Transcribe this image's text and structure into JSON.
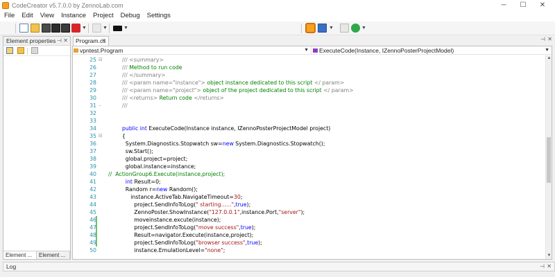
{
  "window": {
    "title": "CodeCreator v5.7.0.0 by ZennoLab.com",
    "minimize": "─",
    "maximize": "☐",
    "close": "✕"
  },
  "menu": [
    "File",
    "Edit",
    "View",
    "Instance",
    "Project",
    "Debug",
    "Settings"
  ],
  "toolbar": {
    "buttons": [
      "new-icon",
      "open-folder-icon",
      "save-icon",
      "save-all-icon",
      "save-as-icon",
      "delete-icon",
      "copy-icon",
      "console-icon",
      "run-project-icon",
      "record-icon",
      "settings-icon",
      "play-icon"
    ],
    "colors": {
      "orange": "#f7a21b",
      "red": "#d4262b",
      "green": "#2ea84a",
      "blue": "#3a6fc4"
    }
  },
  "left_panel": {
    "title": "Element properties",
    "pin": "⊣",
    "close": "✕",
    "tabs": [
      "Element ...",
      "Element ..."
    ]
  },
  "doc_tab": {
    "label": "Program.cs",
    "close": "✕",
    "pin": "⊣",
    "panel_close": "✕"
  },
  "nav": {
    "class_selector": "vpntest.Program",
    "member_selector": "ExecuteCode(Instance, IZennoPosterProjectModel)",
    "dropdown": "▼"
  },
  "code_lines": [
    {
      "num": "25",
      "fold": "⊟",
      "segs": [
        [
          "cg",
          "/// <summary>"
        ]
      ],
      "indent": "        "
    },
    {
      "num": "26",
      "fold": "",
      "segs": [
        [
          "cg",
          "/// "
        ],
        [
          "c",
          "Method to run code"
        ]
      ],
      "indent": "        "
    },
    {
      "num": "27",
      "fold": "",
      "segs": [
        [
          "cg",
          "/// </summary>"
        ]
      ],
      "indent": "        "
    },
    {
      "num": "28",
      "fold": "",
      "segs": [
        [
          "cg",
          "/// <param name=\"instance\">"
        ],
        [
          "c",
          " object instance dedicated to this script "
        ],
        [
          "cg",
          "</ param>"
        ]
      ],
      "indent": "        "
    },
    {
      "num": "29",
      "fold": "",
      "segs": [
        [
          "cg",
          "/// <param name=\"project\">"
        ],
        [
          "c",
          " object of the project dedicated to this script "
        ],
        [
          "cg",
          "</ param>"
        ]
      ],
      "indent": "        "
    },
    {
      "num": "30",
      "fold": "",
      "segs": [
        [
          "cg",
          "/// <returns>"
        ],
        [
          "c",
          " Return code "
        ],
        [
          "cg",
          "</returns>"
        ]
      ],
      "indent": "        "
    },
    {
      "num": "31",
      "fold": "–",
      "segs": [
        [
          "cg",
          "///"
        ]
      ],
      "indent": "        "
    },
    {
      "num": "32",
      "fold": "",
      "segs": [],
      "indent": ""
    },
    {
      "num": "33",
      "fold": "",
      "segs": [],
      "indent": ""
    },
    {
      "num": "34",
      "fold": "",
      "segs": [
        [
          "k",
          "public int "
        ],
        [
          "",
          "ExecuteCode(Instance instance, IZennoPosterProjectModel project)"
        ]
      ],
      "indent": "        "
    },
    {
      "num": "35",
      "fold": "⊟",
      "segs": [
        [
          "",
          "{"
        ]
      ],
      "indent": "        "
    },
    {
      "num": "36",
      "fold": "",
      "segs": [
        [
          "",
          "System.Diagnostics.Stopwatch sw="
        ],
        [
          "k",
          "new "
        ],
        [
          "",
          "System.Diagnostics.Stopwatch();"
        ]
      ],
      "indent": "          "
    },
    {
      "num": "37",
      "fold": "",
      "segs": [
        [
          "",
          "sw.Start();"
        ]
      ],
      "indent": "          "
    },
    {
      "num": "38",
      "fold": "",
      "segs": [
        [
          "",
          "global.project=project;"
        ]
      ],
      "indent": "          "
    },
    {
      "num": "39",
      "fold": "",
      "segs": [
        [
          "",
          "global.instance=instance;"
        ]
      ],
      "indent": "          "
    },
    {
      "num": "40",
      "fold": "",
      "segs": [
        [
          "c",
          "//  ActionGroup6.Execute(instance,project);"
        ]
      ],
      "indent": ""
    },
    {
      "num": "41",
      "fold": "",
      "segs": [
        [
          "k",
          "int "
        ],
        [
          "",
          "Result=0;"
        ]
      ],
      "indent": "          "
    },
    {
      "num": "42",
      "fold": "",
      "segs": [
        [
          "",
          "Random r="
        ],
        [
          "k",
          "new "
        ],
        [
          "",
          "Random();"
        ]
      ],
      "indent": "          "
    },
    {
      "num": "43",
      "fold": "",
      "segs": [
        [
          "",
          "instance.ActiveTab.NavigateTimeout="
        ],
        [
          "s",
          "30"
        ],
        [
          "",
          ";"
        ]
      ],
      "indent": "             "
    },
    {
      "num": "44",
      "fold": "",
      "segs": [
        [
          "",
          "project.SendInfoToLog("
        ],
        [
          "s",
          "\" starting......\""
        ],
        [
          "",
          ","
        ],
        [
          "k",
          "true"
        ],
        [
          "",
          ");"
        ]
      ],
      "indent": "               "
    },
    {
      "num": "45",
      "fold": "",
      "segs": [
        [
          "",
          "ZennoPoster.ShowInstance("
        ],
        [
          "s",
          "\"127.0.0.1\""
        ],
        [
          "",
          ",instance.Port,"
        ],
        [
          "s",
          "\"server\""
        ],
        [
          "",
          ");"
        ]
      ],
      "indent": "               "
    },
    {
      "num": "46",
      "fold": "",
      "segs": [
        [
          "",
          "moveinstance.excute(instance);"
        ]
      ],
      "indent": "               "
    },
    {
      "num": "47",
      "fold": "",
      "segs": [
        [
          "",
          "project.SendInfoToLog("
        ],
        [
          "s",
          "\"move success\""
        ],
        [
          "",
          ","
        ],
        [
          "k",
          "true"
        ],
        [
          "",
          ");"
        ]
      ],
      "indent": "               "
    },
    {
      "num": "48",
      "fold": "",
      "segs": [
        [
          "",
          "Result=navigator.Execute(instance,project);"
        ]
      ],
      "indent": "               "
    },
    {
      "num": "49",
      "fold": "",
      "segs": [
        [
          "",
          "project.SendInfoToLog("
        ],
        [
          "s",
          "\"browser success\""
        ],
        [
          "",
          ","
        ],
        [
          "k",
          "true"
        ],
        [
          "",
          ");"
        ]
      ],
      "indent": "               "
    },
    {
      "num": "50",
      "fold": "",
      "segs": [
        [
          "",
          "instance.EmulationLevel="
        ],
        [
          "s",
          "\"none\""
        ],
        [
          "",
          ";"
        ]
      ],
      "indent": "               "
    }
  ],
  "changed_lines": [
    "46",
    "47",
    "48",
    "49"
  ],
  "scrollbar": {
    "up": "▲",
    "down": "▼"
  },
  "log": {
    "title": "Log",
    "pin": "⊣",
    "close": "✕"
  }
}
